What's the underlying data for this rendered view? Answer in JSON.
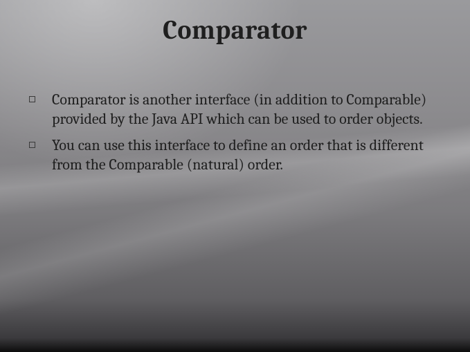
{
  "slide": {
    "title": "Comparator",
    "bullets": [
      "Comparator is another interface (in addition to Comparable) provided by the Java API which can be used to order objects.",
      "You can use this interface to define an order that is different from the Comparable (natural) order."
    ]
  }
}
